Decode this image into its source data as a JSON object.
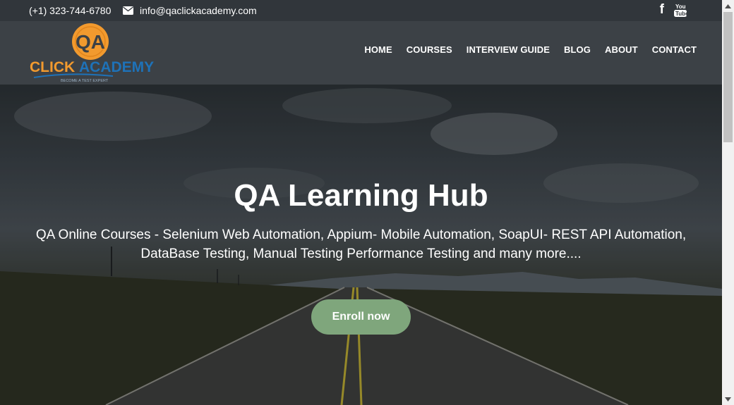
{
  "topbar": {
    "phone": "(+1) 323-744-6780",
    "email": "info@qaclickacademy.com"
  },
  "logo": {
    "mark": "QA",
    "name_part1": "CLICK",
    "name_part2": "ACADEMY",
    "tagline": "BECOME A TEST EXPERT"
  },
  "nav": {
    "items": [
      "HOME",
      "COURSES",
      "INTERVIEW GUIDE",
      "BLOG",
      "ABOUT",
      "CONTACT"
    ]
  },
  "hero": {
    "title": "QA Learning Hub",
    "subtitle_line1": "QA Online Courses - Selenium Web Automation, Appium- Mobile Automation, SoapUI- REST API Automation,",
    "subtitle_line2": "DataBase Testing, Manual Testing Performance Testing and many more....",
    "cta": "Enroll now"
  },
  "colors": {
    "topbar_bg": "#31363b",
    "header_bg": "#3c4146",
    "cta_bg": "#7fa67c",
    "logo_orange": "#f29a2e",
    "logo_blue": "#1e72b8"
  },
  "icons": {
    "email": "envelope-icon",
    "facebook": "facebook-icon",
    "youtube": "youtube-icon"
  }
}
